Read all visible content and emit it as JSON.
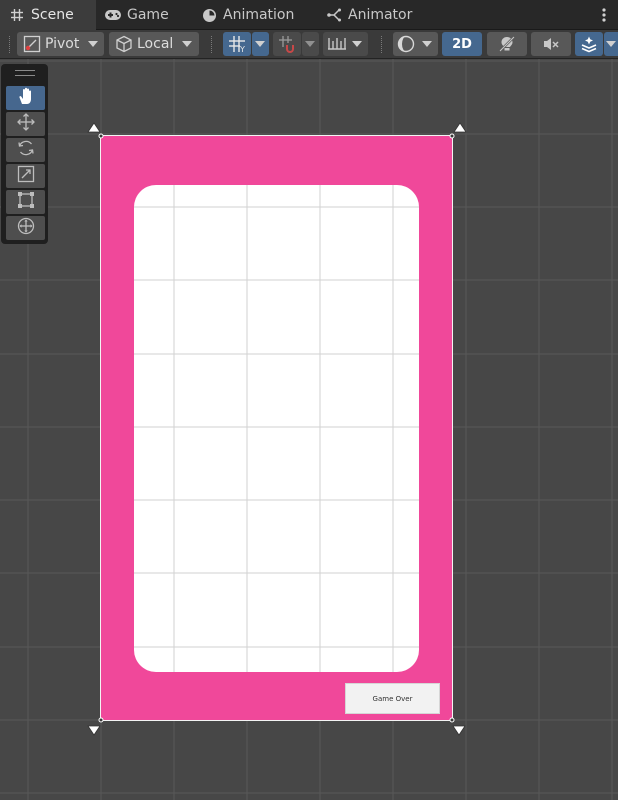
{
  "tabs": [
    {
      "label": "Scene",
      "icon": "hash-grid-icon",
      "active": true
    },
    {
      "label": "Game",
      "icon": "gamepad-icon",
      "active": false
    },
    {
      "label": "Animation",
      "icon": "clock-icon",
      "active": false
    },
    {
      "label": "Animator",
      "icon": "animator-icon",
      "active": false
    }
  ],
  "toolbar": {
    "pivot_label": "Pivot",
    "local_label": "Local",
    "mode_2d_label": "2D"
  },
  "tools": [
    {
      "name": "hand-tool",
      "icon": "hand-icon",
      "active": true
    },
    {
      "name": "move-tool",
      "icon": "move-icon",
      "active": false
    },
    {
      "name": "rotate-tool",
      "icon": "rotate-icon",
      "active": false
    },
    {
      "name": "scale-tool",
      "icon": "scale-icon",
      "active": false
    },
    {
      "name": "rect-tool",
      "icon": "rect-transform-icon",
      "active": false
    },
    {
      "name": "transform-tool",
      "icon": "transform-icon",
      "active": false
    }
  ],
  "scene": {
    "button_label": "Game Over",
    "colors": {
      "canvas_bg": "#f0489a",
      "panel_bg": "#ffffff",
      "scene_bg": "#474747",
      "accent": "#45688f"
    }
  }
}
